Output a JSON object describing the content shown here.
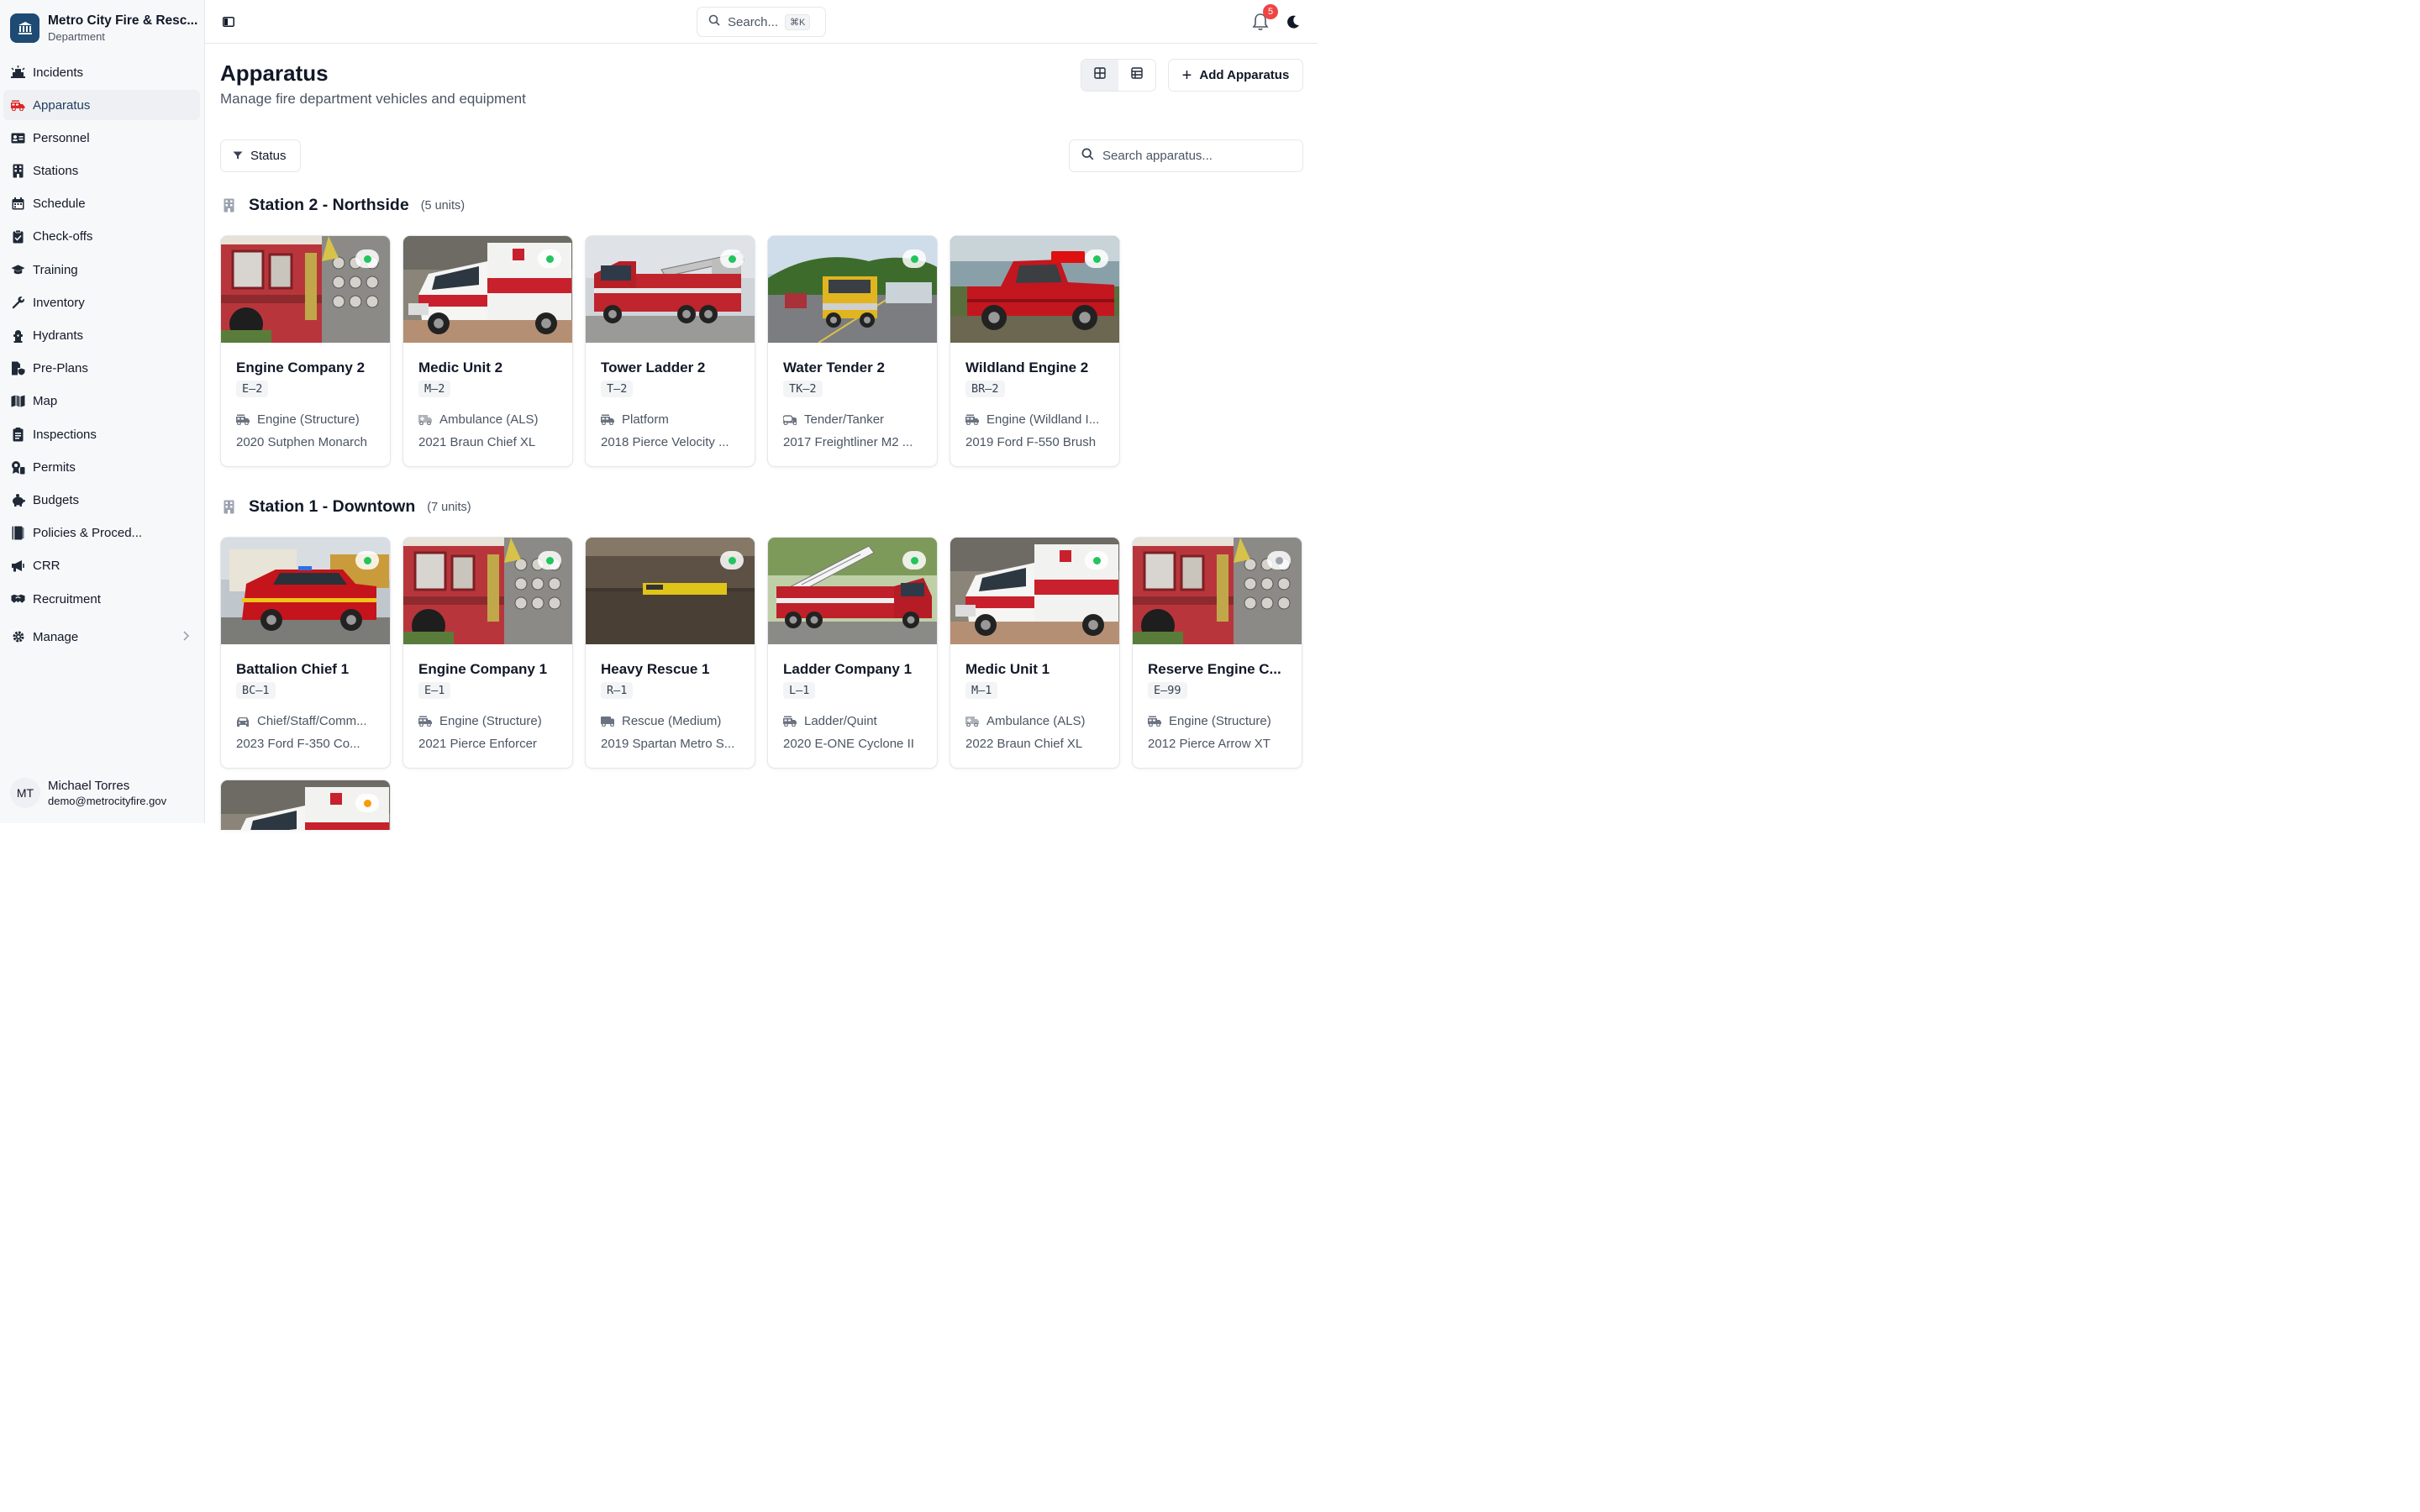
{
  "org": {
    "name": "Metro City Fire & Resc...",
    "subtitle": "Department"
  },
  "nav": {
    "items": [
      {
        "label": "Incidents",
        "icon": "incident-icon"
      },
      {
        "label": "Apparatus",
        "icon": "fire-truck-icon",
        "active": true
      },
      {
        "label": "Personnel",
        "icon": "id-card-icon"
      },
      {
        "label": "Stations",
        "icon": "building-icon"
      },
      {
        "label": "Schedule",
        "icon": "calendar-icon"
      },
      {
        "label": "Check-offs",
        "icon": "clipboard-icon"
      },
      {
        "label": "Training",
        "icon": "graduation-cap-icon"
      },
      {
        "label": "Inventory",
        "icon": "wrench-icon"
      },
      {
        "label": "Hydrants",
        "icon": "hydrant-icon"
      },
      {
        "label": "Pre-Plans",
        "icon": "file-shield-icon"
      },
      {
        "label": "Map",
        "icon": "map-icon"
      },
      {
        "label": "Inspections",
        "icon": "checklist-icon"
      },
      {
        "label": "Permits",
        "icon": "permit-icon"
      },
      {
        "label": "Budgets",
        "icon": "piggy-bank-icon"
      },
      {
        "label": "Policies & Proced...",
        "icon": "book-icon"
      },
      {
        "label": "CRR",
        "icon": "megaphone-icon"
      },
      {
        "label": "Recruitment",
        "icon": "handshake-icon"
      }
    ],
    "manage_label": "Manage"
  },
  "user": {
    "initials": "MT",
    "name": "Michael Torres",
    "email": "demo@metrocityfire.gov"
  },
  "topbar": {
    "search_label": "Search...",
    "shortcut": "⌘K",
    "notification_count": "5"
  },
  "header": {
    "title": "Apparatus",
    "subtitle": "Manage fire department vehicles and equipment",
    "add_label": "Add Apparatus"
  },
  "filters": {
    "status_label": "Status",
    "search_placeholder": "Search apparatus..."
  },
  "colors": {
    "accent": "#1e4b73",
    "status_in_service": "#22c55e",
    "status_reserve": "#9ca3af",
    "status_maintenance": "#f59e0b",
    "badge": "#ef4444"
  },
  "stations": [
    {
      "name": "Station 2 - Northside",
      "count": "(5 units)",
      "units": [
        {
          "name": "Engine Company 2",
          "code": "E–2",
          "type": "Engine (Structure)",
          "type_icon": "fire-truck-icon",
          "model": "2020 Sutphen Monarch",
          "status": "in-service",
          "photo": "engine-closeup"
        },
        {
          "name": "Medic Unit 2",
          "code": "M–2",
          "type": "Ambulance (ALS)",
          "type_icon": "ambulance-icon",
          "model": "2021 Braun Chief XL",
          "status": "in-service",
          "photo": "ambulance"
        },
        {
          "name": "Tower Ladder 2",
          "code": "T–2",
          "type": "Platform",
          "type_icon": "fire-truck-icon",
          "model": "2018 Pierce Velocity ...",
          "status": "in-service",
          "photo": "tower-ladder"
        },
        {
          "name": "Water Tender 2",
          "code": "TK–2",
          "type": "Tender/Tanker",
          "type_icon": "tanker-icon",
          "model": "2017 Freightliner M2 ...",
          "status": "in-service",
          "photo": "tender"
        },
        {
          "name": "Wildland Engine 2",
          "code": "BR–2",
          "type": "Engine (Wildland I...",
          "type_icon": "fire-truck-icon",
          "model": "2019 Ford F-550 Brush",
          "status": "in-service",
          "photo": "pickup"
        }
      ]
    },
    {
      "name": "Station 1 - Downtown",
      "count": "(7 units)",
      "units": [
        {
          "name": "Battalion Chief 1",
          "code": "BC–1",
          "type": "Chief/Staff/Comm...",
          "type_icon": "car-icon",
          "model": "2023 Ford F-350 Co...",
          "status": "in-service",
          "photo": "suv"
        },
        {
          "name": "Engine Company 1",
          "code": "E–1",
          "type": "Engine (Structure)",
          "type_icon": "fire-truck-icon",
          "model": "2021 Pierce Enforcer",
          "status": "in-service",
          "photo": "engine-closeup"
        },
        {
          "name": "Heavy Rescue 1",
          "code": "R–1",
          "type": "Rescue (Medium)",
          "type_icon": "rescue-truck-icon",
          "model": "2019 Spartan Metro S...",
          "status": "in-service",
          "photo": "rescue"
        },
        {
          "name": "Ladder Company 1",
          "code": "L–1",
          "type": "Ladder/Quint",
          "type_icon": "fire-truck-icon",
          "model": "2020 E-ONE Cyclone II",
          "status": "in-service",
          "photo": "ladder"
        },
        {
          "name": "Medic Unit 1",
          "code": "M–1",
          "type": "Ambulance (ALS)",
          "type_icon": "ambulance-icon",
          "model": "2022 Braun Chief XL",
          "status": "in-service",
          "photo": "ambulance"
        },
        {
          "name": "Reserve Engine C...",
          "code": "E–99",
          "type": "Engine (Structure)",
          "type_icon": "fire-truck-icon",
          "model": "2012 Pierce Arrow XT",
          "status": "reserve",
          "photo": "engine-closeup"
        },
        {
          "name": "",
          "code": "",
          "type": "",
          "type_icon": "",
          "model": "",
          "status": "maintenance",
          "photo": "ambulance",
          "partial": true
        }
      ]
    }
  ]
}
